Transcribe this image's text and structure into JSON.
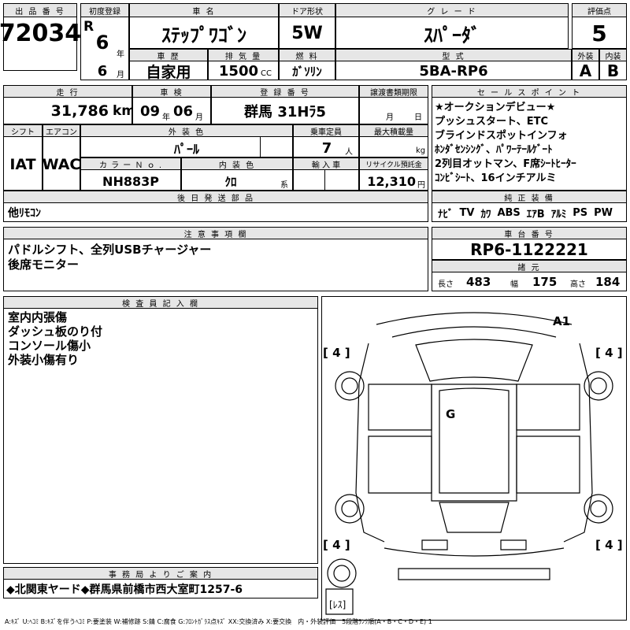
{
  "header": {
    "lot_label": "出 品 番 号",
    "lot_no": "72034",
    "first_reg_label": "初度登録",
    "era": "R",
    "year": "6",
    "year_unit": "年",
    "month": "6",
    "month_unit": "月",
    "car_name_label": "車 名",
    "car_name": "ｽﾃｯﾌﾟﾜｺﾞﾝ",
    "door_label": "ドア形状",
    "door": "5W",
    "grade_label": "グ レ ー ド",
    "grade": "ｽﾊﾟｰﾀﾞ",
    "score_label": "評価点",
    "score": "5",
    "history_label": "車 歴",
    "history": "自家用",
    "displacement_label": "排 気 量",
    "displacement": "1500",
    "displacement_unit": "CC",
    "fuel_label": "燃 料",
    "fuel": "ｶﾞｿﾘﾝ",
    "model_label": "型 式",
    "model": "5BA-RP6",
    "ext_label": "外装",
    "ext": "A",
    "int_label": "内装",
    "int": "B"
  },
  "row2": {
    "mileage_label": "走 行",
    "mileage": "31,786",
    "mileage_unit": "km",
    "inspection_label": "車 検",
    "insp_year": "09",
    "insp_year_unit": "年",
    "insp_month": "06",
    "insp_month_unit": "月",
    "reg_no_label": "登 録 番 号",
    "reg_no": "群馬 31Hﾗ5",
    "transfer_label": "譲渡書類期限",
    "transfer_month_unit": "月",
    "transfer_day_unit": "日",
    "shift_label": "シフト",
    "shift": "IAT",
    "ac_label": "エアコン",
    "ac": "WAC",
    "color_label": "外 装 色",
    "color": "ﾊﾟｰﾙ",
    "capacity_label": "乗車定員",
    "capacity": "7",
    "capacity_unit": "人",
    "load_label": "最大積載量",
    "load_unit": "kg",
    "color_no_label": "カ ラ ー Ｎ ｏ .",
    "color_no": "NH883P",
    "interior_color_label": "内 装 色",
    "interior_color": "ｸﾛ",
    "interior_unit": "系",
    "import_label": "輸 入 車",
    "recycle_label": "リサイクル預託金",
    "recycle": "12,310",
    "recycle_unit": "円",
    "later_label": "後 日 発 送 部 品",
    "later": "他ﾘﾓｺﾝ"
  },
  "sales": {
    "label": "セ ー ル ス ポ イ ン ト",
    "lines": [
      "★オークションデビュー★",
      "プッシュスタート、ETC",
      "ブラインドスポットインフォ",
      "ﾎﾝﾀﾞｾﾝｼﾝｸﾞ、ﾊﾟﾜｰﾃｰﾙｹﾞｰﾄ",
      "2列目オットマン、F席ｼｰﾄﾋｰﾀｰ",
      "ｺﾝﾋﾞｼｰﾄ、16インチアルミ"
    ]
  },
  "equipment": {
    "label": "純 正 装 備",
    "items": [
      "ﾅﾋﾞ",
      "TV",
      "ｶﾜ",
      "ABS",
      "ｴｱB",
      "ｱﾙﾐ",
      "PS",
      "PW"
    ]
  },
  "notes": {
    "label": "注 意 事 項 欄",
    "lines": [
      "パドルシフト、全列USBチャージャー",
      "後席モニター"
    ]
  },
  "chassis": {
    "label": "車 台 番 号",
    "number": "RP6-1122221",
    "spec_label": "諸 元",
    "length_label": "長さ",
    "length": "483",
    "width_label": "幅",
    "width": "175",
    "height_label": "高さ",
    "height": "184"
  },
  "inspector": {
    "label": "検 査 員 記 入 欄",
    "lines": [
      "室内内張傷",
      "ダッシュ板のり付",
      "コンソール傷小",
      "外装小傷有り"
    ]
  },
  "diagram": {
    "mark_a1": "A1",
    "mark_g": "G",
    "tire_fl": "[ 4 ]",
    "tire_fr": "[ 4 ]",
    "tire_rl": "[ 4 ]",
    "tire_rr": "[ 4 ]",
    "spare": "[ﾚｽ]"
  },
  "office": {
    "label": "事 務 局 よ り ご 案 内",
    "text": "◆北関東ヤード◆群馬県前橋市西大室町1257-6"
  },
  "legend": "A:ｷｽﾞ U:ﾍｺﾐ B:ｷｽﾞを伴うﾍｺﾐ P:要塗装 W:補修跡 S:錆 C:腐食 G:ﾌﾛﾝﾄｶﾞﾗｽ点ｷｽﾞ XX:交換済み X:要交換　内・外装評価　5段階ﾗﾝｸ順(A・B・C・D・E) 1"
}
